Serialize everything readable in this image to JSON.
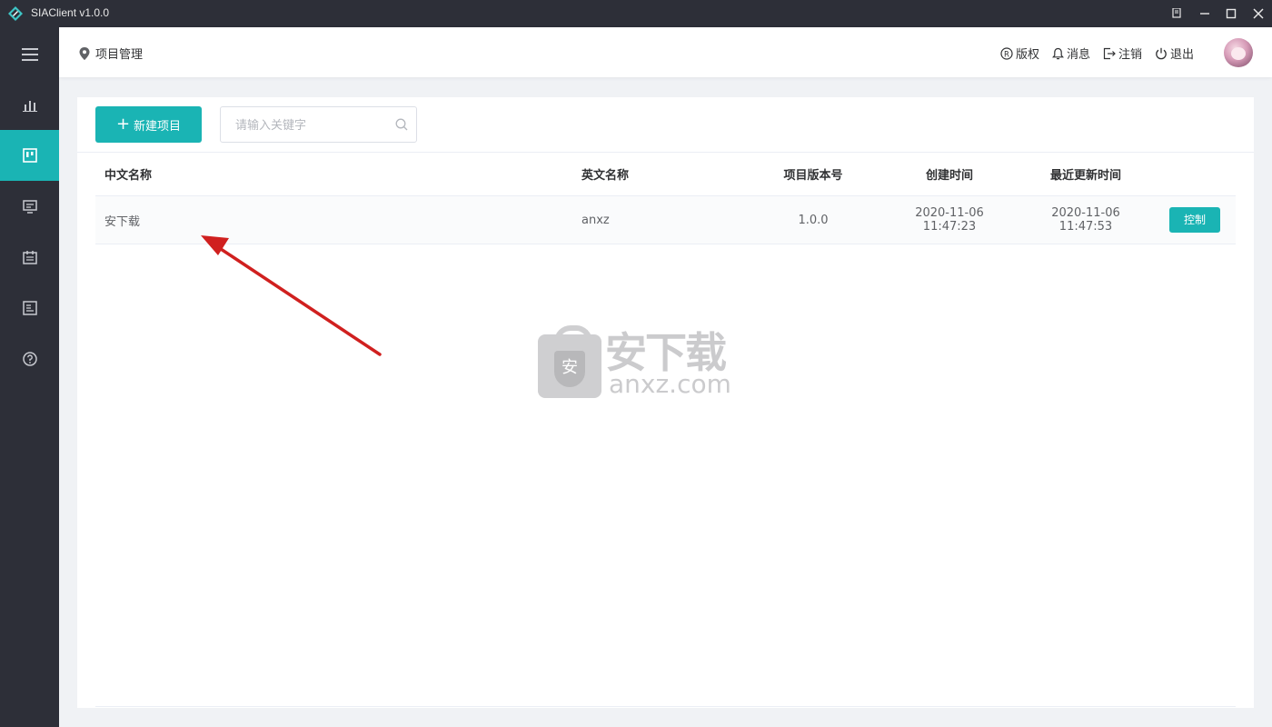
{
  "window": {
    "title": "SIAClient v1.0.0"
  },
  "sidebar": {
    "items": [
      {
        "icon": "menu-icon"
      },
      {
        "icon": "bar-chart-icon"
      },
      {
        "icon": "project-board-icon",
        "active": true
      },
      {
        "icon": "monitor-icon"
      },
      {
        "icon": "calendar-icon"
      },
      {
        "icon": "document-icon"
      },
      {
        "icon": "help-icon"
      }
    ]
  },
  "header": {
    "breadcrumb": "项目管理",
    "actions": {
      "copyright": "版权",
      "messages": "消息",
      "logout_account": "注销",
      "exit": "退出"
    }
  },
  "toolbar": {
    "new_project_label": "新建项目",
    "search_placeholder": "请输入关键字"
  },
  "table": {
    "columns": {
      "cn_name": "中文名称",
      "en_name": "英文名称",
      "version": "项目版本号",
      "created": "创建时间",
      "updated": "最近更新时间"
    },
    "rows": [
      {
        "cn_name": "安下载",
        "en_name": "anxz",
        "version": "1.0.0",
        "created": "2020-11-06 11:47:23",
        "updated": "2020-11-06 11:47:53",
        "action": "控制"
      }
    ]
  },
  "watermark": {
    "badge": "安",
    "cn": "安下载",
    "en": "anxz.com"
  },
  "colors": {
    "accent": "#1ab4b4",
    "sidebar_bg": "#2d2f38",
    "annotation_arrow": "#d0201f"
  }
}
